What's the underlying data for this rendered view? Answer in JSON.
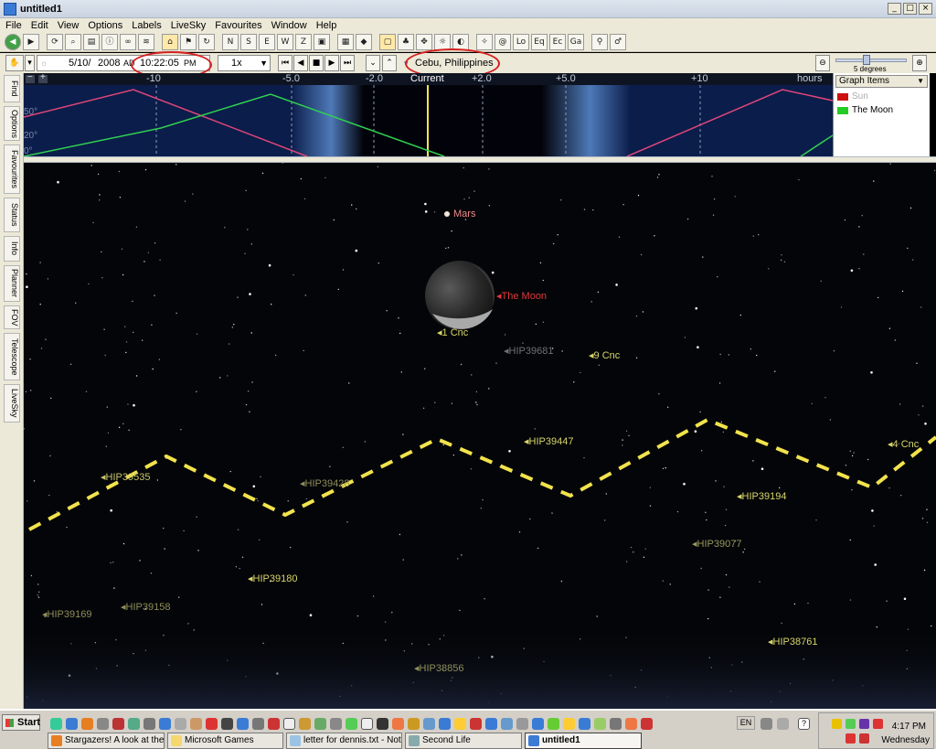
{
  "window": {
    "title": "untitled1",
    "controls": [
      "_",
      "□",
      "×"
    ]
  },
  "menu": [
    "File",
    "Edit",
    "View",
    "Options",
    "Labels",
    "LiveSky",
    "Favourites",
    "Window",
    "Help"
  ],
  "time_bar": {
    "date": "5/10/",
    "year": "2008",
    "era": "AD",
    "time": "10:22:05",
    "ampm": "PM",
    "rate": "1x",
    "location": "Cebu, Philippines",
    "zoom_label": "5 degrees"
  },
  "graph": {
    "ticks": [
      "-10",
      "-5.0",
      "-2.0",
      "Current",
      "+2.0",
      "+5.0",
      "+10",
      "hours"
    ],
    "altitude_labels": [
      "50°",
      "20°",
      "0°"
    ],
    "legend_title": "Graph Items",
    "items": [
      {
        "name": "Sun",
        "color": "#cc1111",
        "enabled": false
      },
      {
        "name": "The Moon",
        "color": "#22cc22",
        "enabled": true
      }
    ]
  },
  "side_tabs": [
    "Find",
    "Options",
    "Favourites",
    "Status",
    "Info",
    "Planner",
    "FOV",
    "Telescope",
    "LiveSky"
  ],
  "sky": {
    "planets": [
      {
        "name": "Mars"
      },
      {
        "name": "The Moon"
      }
    ],
    "stars": [
      {
        "name": "1 Cnc",
        "color": "#d8d66a"
      },
      {
        "name": "HIP39681",
        "color": "#707070"
      },
      {
        "name": "9 Cnc",
        "color": "#d8d66a"
      },
      {
        "name": "HIP39447",
        "color": "#d8d66a"
      },
      {
        "name": "4 Cnc",
        "color": "#d8d66a"
      },
      {
        "name": "HIP39535",
        "color": "#c7c56a"
      },
      {
        "name": "HIP39428",
        "color": "#8f8e5a"
      },
      {
        "name": "HIP39194",
        "color": "#d8d66a"
      },
      {
        "name": "HIP39077",
        "color": "#9a9860"
      },
      {
        "name": "HIP39180",
        "color": "#d8d66a"
      },
      {
        "name": "HIP39158",
        "color": "#8f8e5a"
      },
      {
        "name": "HIP39169",
        "color": "#8f8e5a"
      },
      {
        "name": "HIP38761",
        "color": "#d8d66a"
      },
      {
        "name": "HIP38856",
        "color": "#8f8e5a"
      }
    ]
  },
  "taskbar": {
    "start": "Start",
    "tasks": [
      {
        "label": "Stargazers! A look at the ...",
        "active": false
      },
      {
        "label": "Microsoft Games",
        "active": false
      },
      {
        "label": "letter for dennis.txt - Note...",
        "active": false
      },
      {
        "label": "Second Life",
        "active": false
      },
      {
        "label": "untitled1",
        "active": true
      }
    ],
    "language": "EN",
    "clock": "4:17 PM",
    "day": "Wednesday"
  },
  "colors": {
    "annotation": "#d61f1f",
    "horizon_line": "#f2e34c",
    "sun_curve": "#e0457a",
    "moon_curve": "#2fd150"
  }
}
